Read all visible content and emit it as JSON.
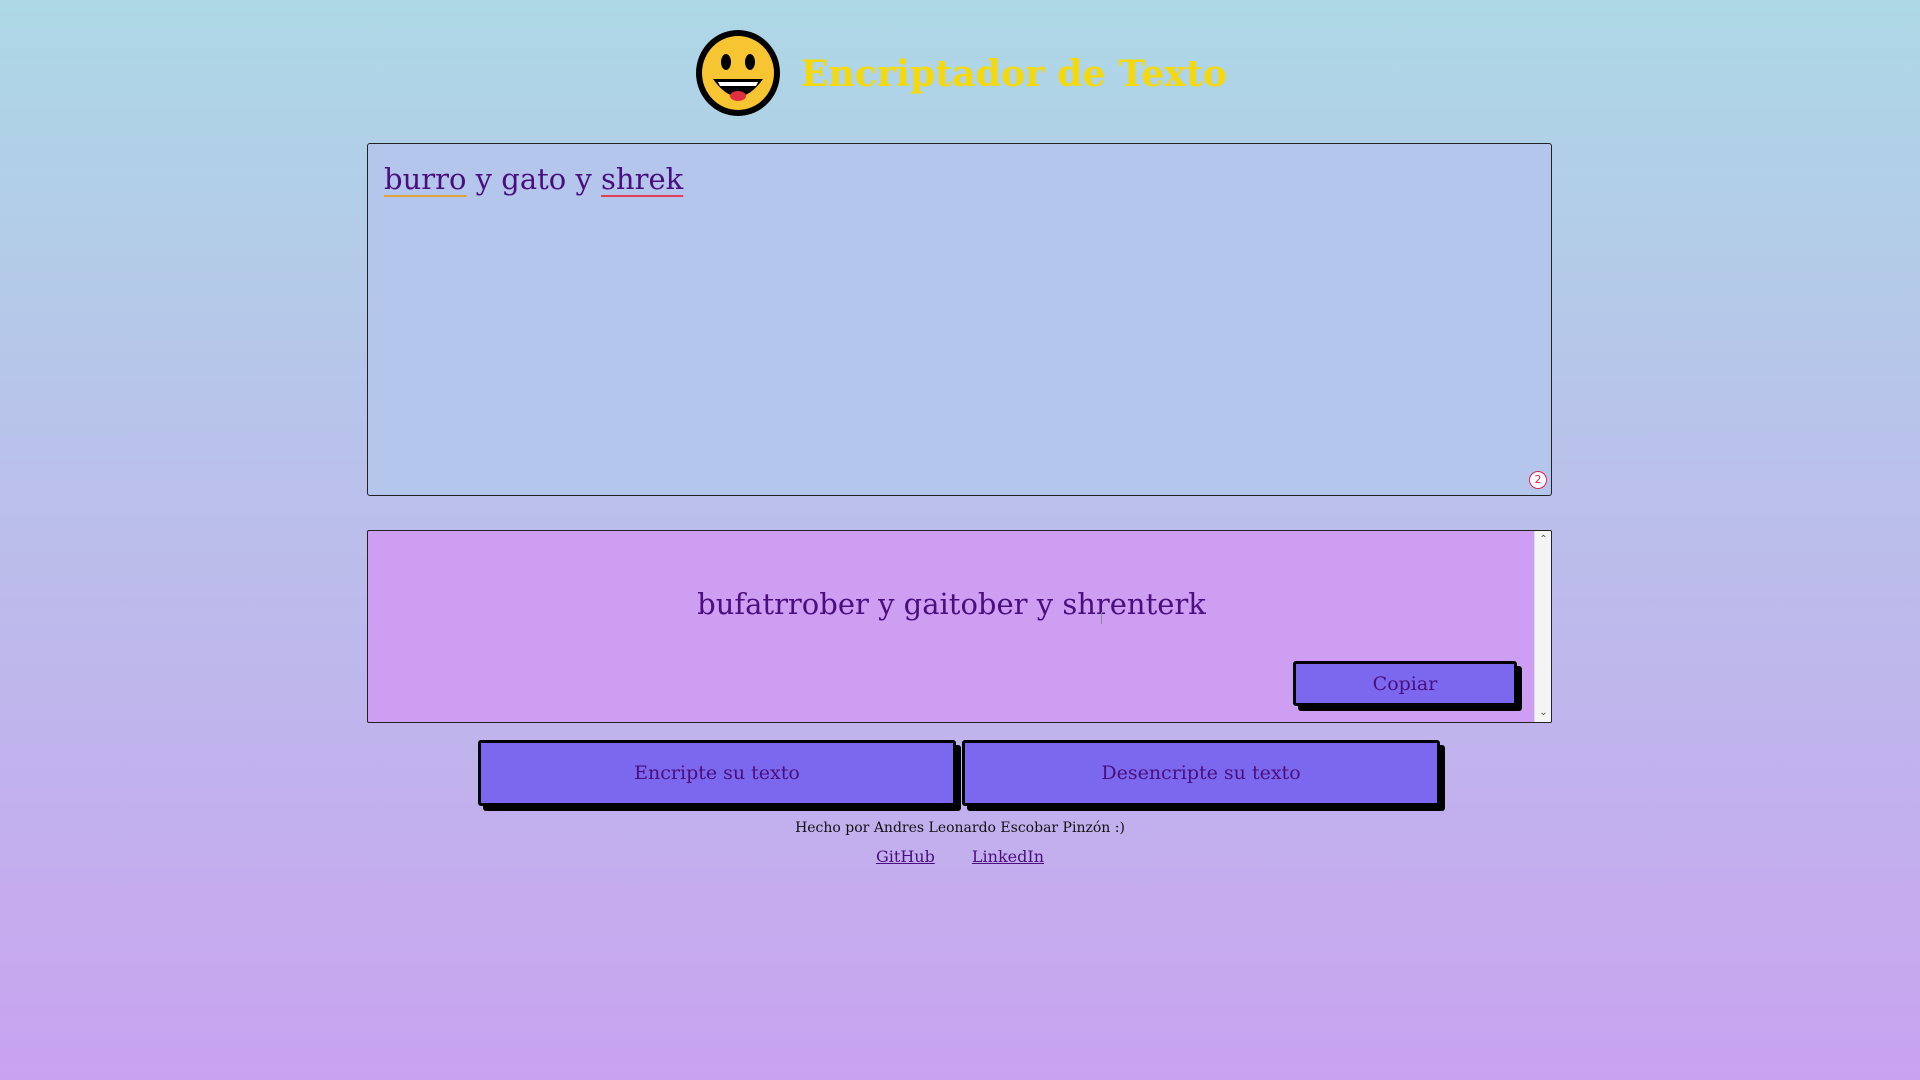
{
  "header": {
    "title": "Encriptador de Texto",
    "logo_icon": "grinning-face-icon"
  },
  "input": {
    "words": [
      "burro",
      " y gato y ",
      "shrek"
    ],
    "badge_count": "2"
  },
  "output": {
    "text": "bufatrrober y gaitober y shrenterk",
    "copy_label": "Copiar"
  },
  "actions": {
    "encrypt_label": "Encripte su texto",
    "decrypt_label": "Desencripte su texto"
  },
  "footer": {
    "credit": "Hecho por Andres Leonardo Escobar Pinzón :)",
    "github_label": "GitHub",
    "linkedin_label": "LinkedIn"
  },
  "colors": {
    "title": "#F5D90A",
    "button": "#7B68EE",
    "text": "#4B0E7E",
    "input_bg": "#B4C6EC",
    "output_bg": "#CD9EF2"
  }
}
